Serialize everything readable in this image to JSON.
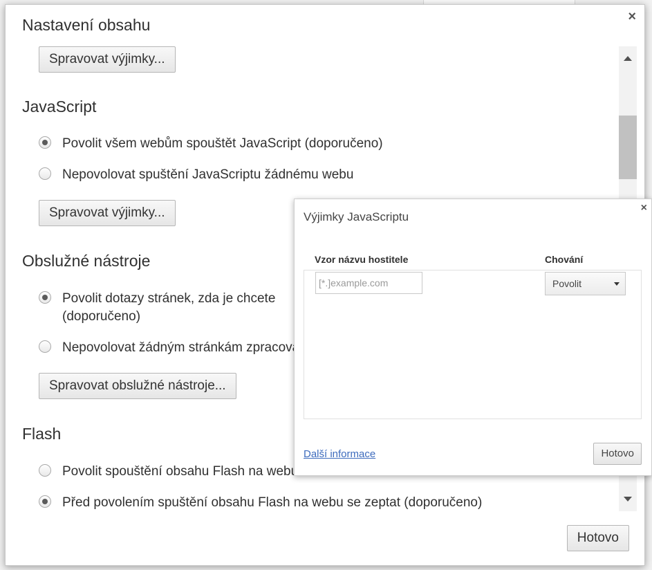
{
  "dialog": {
    "title": "Nastavení obsahu",
    "close_glyph": "×",
    "done_label": "Hotovo"
  },
  "sections": {
    "top_manage_exceptions": "Spravovat výjimky...",
    "javascript": {
      "title": "JavaScript",
      "options": [
        {
          "label": "Povolit všem webům spouštět JavaScript (doporučeno)",
          "checked": true
        },
        {
          "label": "Nepovolovat spuštění JavaScriptu žádnému webu",
          "checked": false
        }
      ],
      "manage_label": "Spravovat výjimky..."
    },
    "handlers": {
      "title": "Obslužné nástroje",
      "options": [
        {
          "label": "Povolit dotazy stránek, zda je chcete",
          "label_line2": "(doporučeno)",
          "checked": true
        },
        {
          "label": "Nepovolovat žádným stránkám zpracování",
          "checked": false
        }
      ],
      "manage_label": "Spravovat obslužné nástroje..."
    },
    "flash": {
      "title": "Flash",
      "options": [
        {
          "label": "Povolit spouštění obsahu Flash na webu",
          "checked": false
        },
        {
          "label": "Před povolením spuštění obsahu Flash na webu se zeptat (doporučeno)",
          "checked": true
        }
      ]
    }
  },
  "exceptions_dialog": {
    "title": "Výjimky JavaScriptu",
    "close_glyph": "×",
    "col_host": "Vzor názvu hostitele",
    "col_behavior": "Chování",
    "host_placeholder": "[*.]example.com",
    "behavior_value": "Povolit",
    "more_info": "Další informace",
    "done_label": "Hotovo"
  }
}
